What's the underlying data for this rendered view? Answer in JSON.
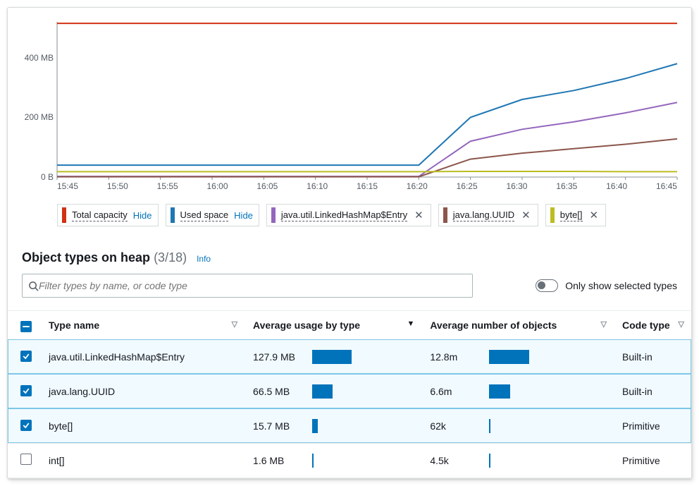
{
  "chart_data": {
    "type": "line",
    "x": [
      "15:45",
      "15:50",
      "15:55",
      "16:00",
      "16:05",
      "16:10",
      "16:15",
      "16:20",
      "16:25",
      "16:30",
      "16:35",
      "16:40",
      "16:45"
    ],
    "ylabel": "",
    "xlabel": "",
    "ylim_mb": [
      0,
      520
    ],
    "y_ticks": [
      {
        "label": "400 MB",
        "value": 400
      },
      {
        "label": "200 MB",
        "value": 200
      },
      {
        "label": "0 B",
        "value": 0
      }
    ],
    "series": [
      {
        "name": "Total capacity",
        "color": "#d13212",
        "action": "Hide",
        "values_mb": [
          515,
          515,
          515,
          515,
          515,
          515,
          515,
          515,
          515,
          515,
          515,
          515,
          515
        ]
      },
      {
        "name": "Used space",
        "color": "#1f77b4",
        "action": "Hide",
        "values_mb": [
          40,
          40,
          40,
          40,
          40,
          40,
          40,
          40,
          200,
          260,
          290,
          330,
          380
        ]
      },
      {
        "name": "java.util.LinkedHashMap$Entry",
        "color": "#9467bd",
        "action": "Close",
        "values_mb": [
          2,
          2,
          2,
          2,
          2,
          2,
          2,
          2,
          120,
          160,
          185,
          215,
          250
        ]
      },
      {
        "name": "java.lang.UUID",
        "color": "#8c564b",
        "action": "Close",
        "values_mb": [
          1,
          1,
          1,
          1,
          1,
          1,
          1,
          1,
          60,
          80,
          95,
          110,
          128
        ]
      },
      {
        "name": "byte[]",
        "color": "#bcbd22",
        "action": "Close",
        "values_mb": [
          18,
          18,
          18,
          18,
          18,
          18,
          18,
          18,
          19,
          19,
          19,
          18,
          18
        ]
      }
    ]
  },
  "section": {
    "title": "Object types on heap",
    "count": "(3/18)",
    "info": "Info"
  },
  "controls": {
    "search_placeholder": "Filter types by name, or code type",
    "toggle_label": "Only show selected types"
  },
  "columns": {
    "type_name": "Type name",
    "avg_usage": "Average usage by type",
    "avg_objects": "Average number of objects",
    "code_type": "Code type"
  },
  "rows": [
    {
      "selected": true,
      "type_name": "java.util.LinkedHashMap$Entry",
      "avg_usage": "127.9 MB",
      "usage_bar": 70,
      "avg_objects": "12.8m",
      "objects_bar": 70,
      "code_type": "Built-in"
    },
    {
      "selected": true,
      "type_name": "java.lang.UUID",
      "avg_usage": "66.5 MB",
      "usage_bar": 36,
      "avg_objects": "6.6m",
      "objects_bar": 36,
      "code_type": "Built-in"
    },
    {
      "selected": true,
      "type_name": "byte[]",
      "avg_usage": "15.7 MB",
      "usage_bar": 9,
      "avg_objects": "62k",
      "objects_bar": 1,
      "code_type": "Primitive"
    },
    {
      "selected": false,
      "type_name": "int[]",
      "avg_usage": "1.6 MB",
      "usage_bar": 1,
      "avg_objects": "4.5k",
      "objects_bar": 1,
      "code_type": "Primitive"
    }
  ]
}
